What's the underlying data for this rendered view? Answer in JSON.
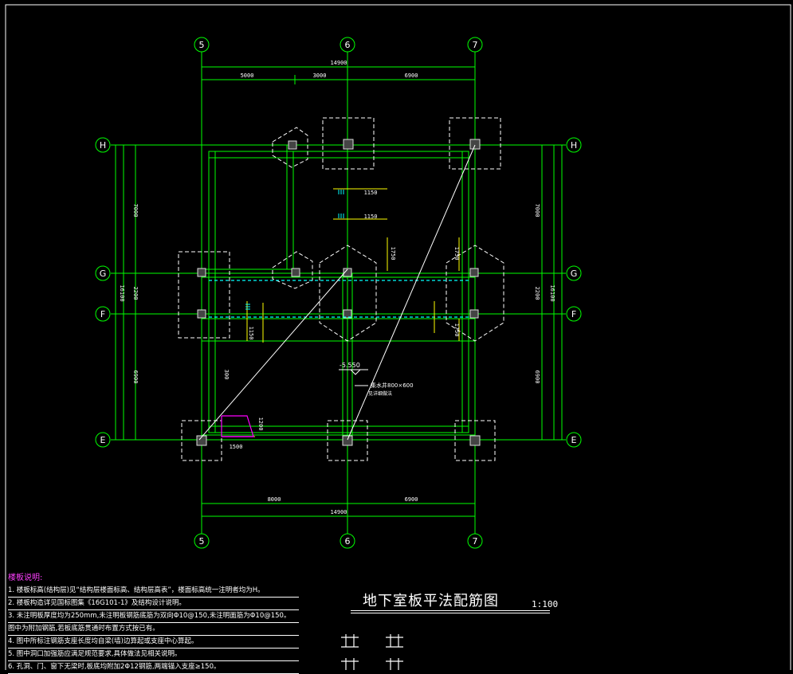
{
  "axes": {
    "columns": [
      "5",
      "6",
      "7"
    ],
    "rows": [
      "H",
      "G",
      "F",
      "E"
    ]
  },
  "dimensions": {
    "top_total": "14900",
    "top_segments": [
      "5000",
      "3000",
      "6900"
    ],
    "bottom_total": "14900",
    "bottom_segments": [
      "8000",
      "6900"
    ],
    "side_total": "16100",
    "side_segments": [
      "7000",
      "2200",
      "6900"
    ],
    "small_1500": "1500",
    "small_1200": "1200",
    "small_300": "300",
    "rebar_1150": "1150",
    "rebar_1750": "1750"
  },
  "annotations": {
    "elevation": "-5.550",
    "pit_label": "集水井800×600",
    "pit_sub": "见详细做法"
  },
  "colors": {
    "grid": "#00ff00",
    "rebar": "#00ffff",
    "dim_yellow": "#ffff00",
    "white": "#ffffff",
    "magenta": "#ff00ff"
  },
  "notes": {
    "title": "楼板说明:",
    "lines": [
      "1. 楼板标高(结构层)见“结构层楼面标高、结构层高表”，楼面标高统一注明者均为H。",
      "2. 楼板构造详见国标图集《16G101-1》及结构设计说明。",
      "3. 未注明板厚度均为250mm,未注明板钢筋底筋为双向Φ10@150,未注明面筋为Φ10@150。",
      "   图中为附加钢筋,若板底筋贯通时布置方式按已有。",
      "4. 图中所标注钢筋支座长度均自梁(墙)边算起或支座中心算起。",
      "5. 图中洞口加强筋应满足规范要求,具体做法见相关说明。",
      "6. 孔洞、门、窗下无梁时,板底均附加2Φ12钢筋,两端锚入支座≥150。"
    ]
  },
  "title_block": {
    "drawing_title": "地下室板平法配筋图",
    "scale": "1:100"
  }
}
